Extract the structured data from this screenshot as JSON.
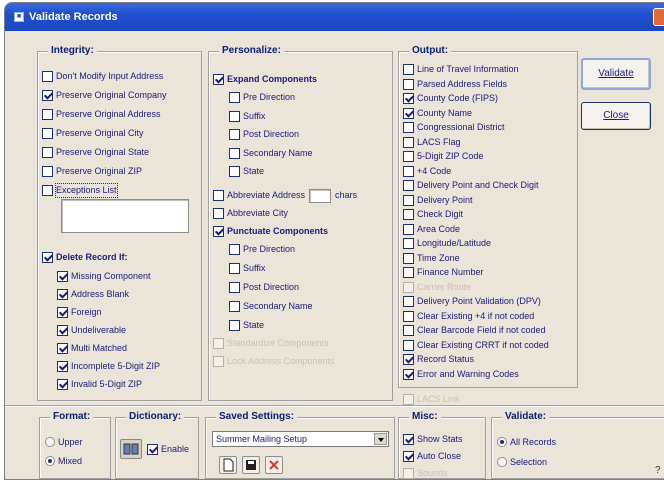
{
  "window": {
    "title": "Validate Records"
  },
  "integrity": {
    "legend": "Integrity:",
    "options": [
      {
        "label": "Don't Modify Input Address",
        "checked": false
      },
      {
        "label": "Preserve Original Company",
        "checked": true
      },
      {
        "label": "Preserve Original Address",
        "checked": false
      },
      {
        "label": "Preserve Original City",
        "checked": false
      },
      {
        "label": "Preserve Original State",
        "checked": false
      },
      {
        "label": "Preserve Original ZIP",
        "checked": false
      },
      {
        "label": "Exceptions List",
        "checked": false
      }
    ],
    "delete_record": {
      "label": "Delete Record If:",
      "checked": true,
      "options": [
        {
          "label": "Missing Component",
          "checked": true
        },
        {
          "label": "Address Blank",
          "checked": true
        },
        {
          "label": "Foreign",
          "checked": true
        },
        {
          "label": "Undeliverable",
          "checked": true
        },
        {
          "label": "Multi Matched",
          "checked": true
        },
        {
          "label": "Incomplete 5-Digit ZIP",
          "checked": true
        },
        {
          "label": "Invalid 5-Digit ZIP",
          "checked": true
        }
      ]
    }
  },
  "personalize": {
    "legend": "Personalize:",
    "expand": {
      "label": "Expand Components",
      "checked": true,
      "options": [
        {
          "label": "Pre Direction",
          "checked": false
        },
        {
          "label": "Suffix",
          "checked": false
        },
        {
          "label": "Post Direction",
          "checked": false
        },
        {
          "label": "Secondary Name",
          "checked": false
        },
        {
          "label": "State",
          "checked": false
        }
      ]
    },
    "abbreviate_address": {
      "label": "Abbreviate Address",
      "checked": false,
      "chars_value": "",
      "chars_label": "chars"
    },
    "abbreviate_city": {
      "label": "Abbreviate City",
      "checked": false
    },
    "punctuate": {
      "label": "Punctuate Components",
      "checked": true,
      "options": [
        {
          "label": "Pre Direction",
          "checked": false
        },
        {
          "label": "Suffix",
          "checked": false
        },
        {
          "label": "Post Direction",
          "checked": false
        },
        {
          "label": "Secondary Name",
          "checked": false
        },
        {
          "label": "State",
          "checked": false
        }
      ]
    },
    "disabled_options": [
      "Standardize Components",
      "Lock Address Components"
    ]
  },
  "output": {
    "legend": "Output:",
    "options": [
      {
        "label": "Line of Travel Information",
        "checked": false
      },
      {
        "label": "Parsed Address Fields",
        "checked": false
      },
      {
        "label": "County Code (FIPS)",
        "checked": true
      },
      {
        "label": "County Name",
        "checked": true
      },
      {
        "label": "Congressional District",
        "checked": false
      },
      {
        "label": "LACS Flag",
        "checked": false
      },
      {
        "label": "5-Digit ZIP Code",
        "checked": false
      },
      {
        "label": "+4 Code",
        "checked": false
      },
      {
        "label": "Delivery Point and Check Digit",
        "checked": false
      },
      {
        "label": "Delivery Point",
        "checked": false
      },
      {
        "label": "Check Digit",
        "checked": false
      },
      {
        "label": "Area Code",
        "checked": false
      },
      {
        "label": "Longitude/Latitude",
        "checked": false
      },
      {
        "label": "Time Zone",
        "checked": false
      },
      {
        "label": "Finance Number",
        "checked": false
      },
      {
        "label": "Carrier Route",
        "checked": false,
        "disabled": true
      },
      {
        "label": "Delivery Point Validation (DPV)",
        "checked": false
      },
      {
        "label": "Clear Existing +4 if not coded",
        "checked": false
      },
      {
        "label": "Clear Barcode Field if not coded",
        "checked": false
      },
      {
        "label": "Clear Existing CRRT if not coded",
        "checked": false
      },
      {
        "label": "Record Status",
        "checked": true
      },
      {
        "label": "Error and Warning Codes",
        "checked": true
      }
    ],
    "extra_disabled": "LACS Link"
  },
  "buttons": {
    "validate": "Validate",
    "close": "Close"
  },
  "format": {
    "legend": "Format:",
    "options": [
      {
        "label": "Upper",
        "selected": false
      },
      {
        "label": "Mixed",
        "selected": true
      }
    ]
  },
  "dictionary": {
    "legend": "Dictionary:",
    "enable_label": "Enable",
    "enable_checked": true
  },
  "saved_settings": {
    "legend": "Saved Settings:",
    "selected": "Summer Mailing Setup"
  },
  "misc": {
    "legend": "Misc:",
    "options": [
      {
        "label": "Show Stats",
        "checked": true
      },
      {
        "label": "Auto Close",
        "checked": true
      },
      {
        "label": "Sounds",
        "checked": false,
        "disabled": true
      }
    ]
  },
  "validate_scope": {
    "legend": "Validate:",
    "options": [
      {
        "label": "All Records",
        "selected": true
      },
      {
        "label": "Selection",
        "selected": false
      }
    ]
  },
  "help": "?",
  "colors": {
    "title_bar": "#1f4fd0",
    "dialog_bg": "#eae4d9",
    "label_text": "#1a1a7a"
  }
}
